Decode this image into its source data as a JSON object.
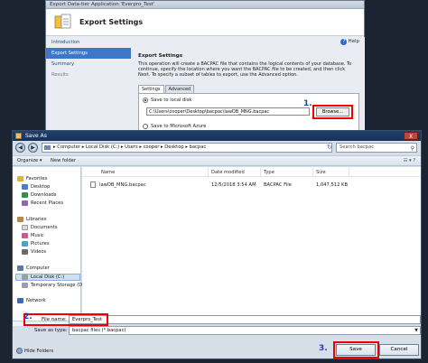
{
  "wizard": {
    "window_title": "Export Data-tier Application 'Everpro_Test'",
    "heading": "Export Settings",
    "help_label": "Help",
    "nav": [
      "Introduction",
      "Export Settings",
      "Summary",
      "Results"
    ],
    "section_title": "Export Settings",
    "description": "This operation will create a BACPAC file that contains the logical contents of your database. To continue, specify the location where you want the BACPAC file to be created, and then click Next. To specify a subset of tables to export, use the Advanced option.",
    "tabs": [
      "Settings",
      "Advanced"
    ],
    "option_local": "Save to local disk",
    "local_path": "C:\\Users\\cooper\\Desktop\\bacpac\\lawDB_MNG.bacpac",
    "browse_label": "Browse...",
    "option_azure": "Save to Microsoft Azure",
    "step_label": "1."
  },
  "dialog": {
    "title": "Save As",
    "close_glyph": "X",
    "breadcrumb": "▸ Computer ▸ Local Disk (C:) ▸ Users ▸ cooper ▸ Desktop ▸ bacpac",
    "search_placeholder": "Search bacpac",
    "toolbar": {
      "organize": "Organize ▾",
      "new_folder": "New folder"
    },
    "tree": {
      "favorites": "Favorites",
      "desktop": "Desktop",
      "downloads": "Downloads",
      "recent": "Recent Places",
      "libraries": "Libraries",
      "documents": "Documents",
      "music": "Music",
      "pictures": "Pictures",
      "videos": "Videos",
      "computer": "Computer",
      "local_disk": "Local Disk (C:)",
      "temp_storage": "Temporary Storage (D",
      "network": "Network"
    },
    "columns": [
      "Name",
      "Date modified",
      "Type",
      "Size"
    ],
    "files": [
      {
        "name": "lawDB_MNG.bacpac",
        "date": "12/5/2018 3:54 AM",
        "type": "BACPAC File",
        "size": "1,047,512 KB"
      }
    ],
    "file_name_label": "File name:",
    "file_name_value": "Everpro_Test",
    "save_type_label": "Save as type:",
    "save_type_value": "bacpac files (*.bacpac)",
    "hide_folders": "Hide Folders",
    "save_label": "Save",
    "cancel_label": "Cancel",
    "step2": "2.",
    "step3": "3."
  },
  "colors": {
    "highlight": "#e00000",
    "step_number": "#1f3fd0",
    "nav_selected": "#3c77c9"
  }
}
